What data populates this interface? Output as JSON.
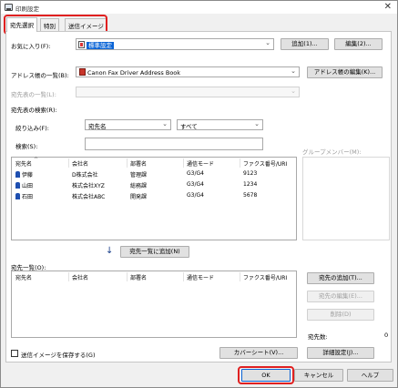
{
  "window": {
    "title": "印刷設定",
    "close": "✕"
  },
  "tabs": [
    {
      "label": "宛先選択"
    },
    {
      "label": "特別"
    },
    {
      "label": "送信イメージ"
    }
  ],
  "favorites": {
    "label": "お気に入り(F):",
    "value": "標準設定",
    "add_button": "追加(1)...",
    "edit_button": "編集(2)..."
  },
  "address_book": {
    "label": "アドレス帳の一覧(B):",
    "value": "Canon Fax Driver Address Book",
    "edit_button": "アドレス帳の編集(K)..."
  },
  "dest_table_list": {
    "label": "宛先表の一覧(L):"
  },
  "search": {
    "section_label": "宛先表の検索(R):",
    "filter_label": "絞り込み(F):",
    "filter_field": "宛先名",
    "filter_value": "すべて",
    "search_label": "検索(S):",
    "search_value": ""
  },
  "group_members_label": "グループメンバー(M):",
  "address_table": {
    "columns": [
      "宛先名",
      "会社名",
      "部署名",
      "通信モード",
      "ファクス番号/URI"
    ],
    "rows": [
      [
        "伊藤",
        "D株式会社",
        "管理課",
        "G3/G4",
        "9123"
      ],
      [
        "山田",
        "株式会社XYZ",
        "総務課",
        "G3/G4",
        "1234"
      ],
      [
        "石田",
        "株式会社ABC",
        "開発課",
        "G3/G4",
        "5678"
      ]
    ]
  },
  "add_to_list_button": "宛先一覧に追加(N)",
  "dest_list": {
    "label": "宛先一覧(O):",
    "columns": [
      "宛先名",
      "会社名",
      "部署名",
      "通信モード",
      "ファクス番号/URI"
    ]
  },
  "side_buttons": {
    "add_dest": "宛先の追加(T)...",
    "edit_dest": "宛先の編集(E)...",
    "delete": "削除(D)"
  },
  "dest_count": {
    "label": "宛先数:",
    "value": "0"
  },
  "save_image": {
    "label": "送信イメージを保存する(G)"
  },
  "cover_sheet_button": "カバーシート(V)...",
  "detail_settings_button": "詳細設定(J)...",
  "footer": {
    "ok": "OK",
    "cancel": "キャンセル",
    "help": "ヘルプ"
  },
  "colors": {
    "highlight": "#e02020",
    "selection": "#0a64d6"
  }
}
